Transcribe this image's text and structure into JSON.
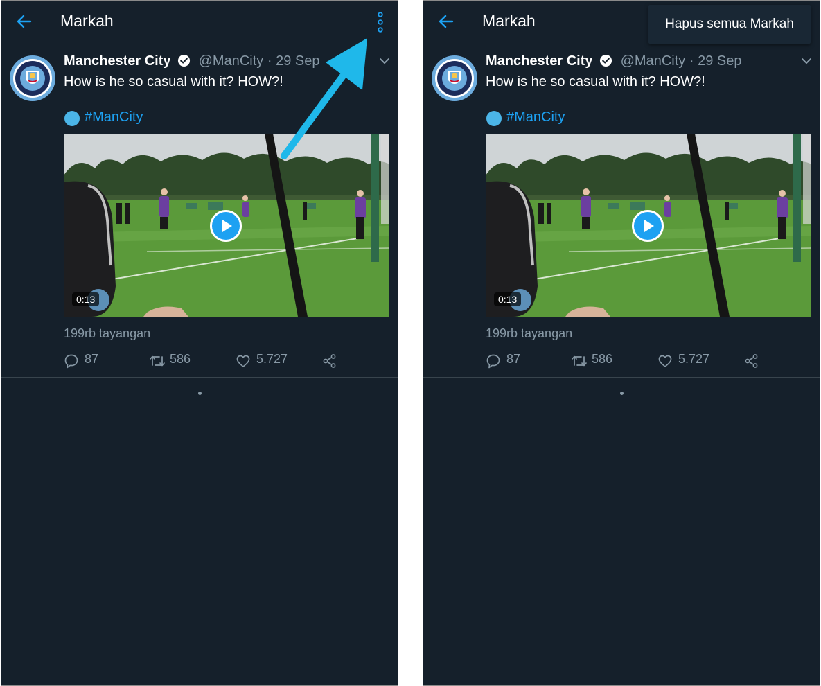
{
  "header": {
    "title": "Markah"
  },
  "menu": {
    "clear_bookmarks": "Hapus semua Markah"
  },
  "tweet": {
    "name": "Manchester City",
    "handle": "@ManCity",
    "separator": "·",
    "date": "29 Sep",
    "text": "How is he so casual with it? HOW?!",
    "hashtag": "#ManCity",
    "video_duration": "0:13",
    "views": "199rb tayangan",
    "replies": "87",
    "retweets": "586",
    "likes": "5.727"
  },
  "icons": {
    "back": "arrow-left-icon",
    "overflow": "vertical-ellipsis-icon",
    "verified": "verified-badge-icon",
    "caret": "chevron-down-icon",
    "play": "play-icon",
    "reply": "reply-icon",
    "retweet": "retweet-icon",
    "like": "heart-icon",
    "share": "share-icon",
    "annotation": "arrow-annotation"
  },
  "colors": {
    "background": "#15202b",
    "accent": "#1da1f2",
    "secondary_text": "#8899a6",
    "divider": "#38444d",
    "annotation_arrow": "#1fb8ea"
  }
}
